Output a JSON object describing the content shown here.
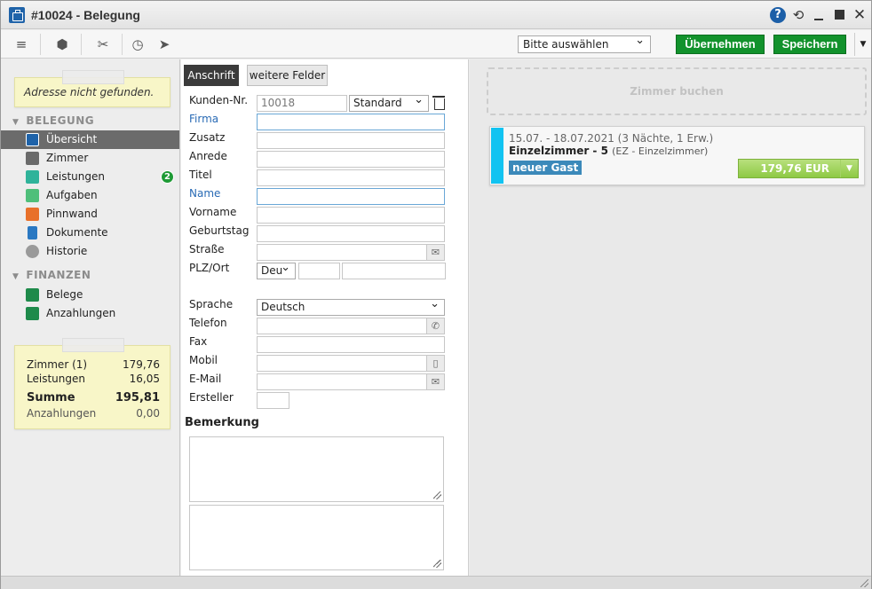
{
  "window": {
    "title": "#10024 - Belegung"
  },
  "toolbar": {
    "select_value": "Bitte auswählen",
    "apply_label": "Übernehmen",
    "save_label": "Speichern"
  },
  "sidebar": {
    "notice": "Adresse nicht gefunden.",
    "section_booking": "BELEGUNG",
    "items": [
      {
        "label": "Übersicht",
        "icon": "overview-icon",
        "color": "#1f63a9"
      },
      {
        "label": "Zimmer",
        "icon": "room-icon",
        "color": "#555555"
      },
      {
        "label": "Leistungen",
        "icon": "services-icon",
        "color": "#2fb39a",
        "badge": "2"
      },
      {
        "label": "Aufgaben",
        "icon": "tasks-icon",
        "color": "#4fbf7a"
      },
      {
        "label": "Pinnwand",
        "icon": "pinboard-icon",
        "color": "#e8702a"
      },
      {
        "label": "Dokumente",
        "icon": "documents-icon",
        "color": "#2a78c2"
      },
      {
        "label": "Historie",
        "icon": "history-icon",
        "color": "#999999"
      }
    ],
    "section_finance": "FINANZEN",
    "finance_items": [
      {
        "label": "Belege",
        "icon": "receipts-icon",
        "color": "#1e8a4a"
      },
      {
        "label": "Anzahlungen",
        "icon": "deposits-icon",
        "color": "#1e8a4a"
      }
    ],
    "summary": {
      "rooms_label": "Zimmer (1)",
      "rooms_value": "179,76",
      "services_label": "Leistungen",
      "services_value": "16,05",
      "total_label": "Summe",
      "total_value": "195,81",
      "deposits_label": "Anzahlungen",
      "deposits_value": "0,00"
    }
  },
  "form": {
    "tabs": [
      "Anschrift",
      "weitere Felder"
    ],
    "customer_no_label": "Kunden-Nr.",
    "customer_no": "10018",
    "customer_type": "Standard",
    "company_label": "Firma",
    "addition_label": "Zusatz",
    "salutation_label": "Anrede",
    "title_label": "Titel",
    "name_label": "Name",
    "firstname_label": "Vorname",
    "birthday_label": "Geburtstag",
    "street_label": "Straße",
    "zip_city_label": "PLZ/Ort",
    "country": "Deu",
    "language_label": "Sprache",
    "language": "Deutsch",
    "phone_label": "Telefon",
    "fax_label": "Fax",
    "mobile_label": "Mobil",
    "email_label": "E-Mail",
    "creator_label": "Ersteller",
    "remark_title": "Bemerkung"
  },
  "booking": {
    "placeholder": "Zimmer buchen",
    "dates": "15.07. - 18.07.2021 (3 Nächte, 1 Erw.)",
    "room": "Einzelzimmer - 5",
    "room_type": "(EZ - Einzelzimmer)",
    "guest_badge": "neuer Gast",
    "price": "179,76 EUR",
    "stripe_color": "#11c3f1"
  }
}
